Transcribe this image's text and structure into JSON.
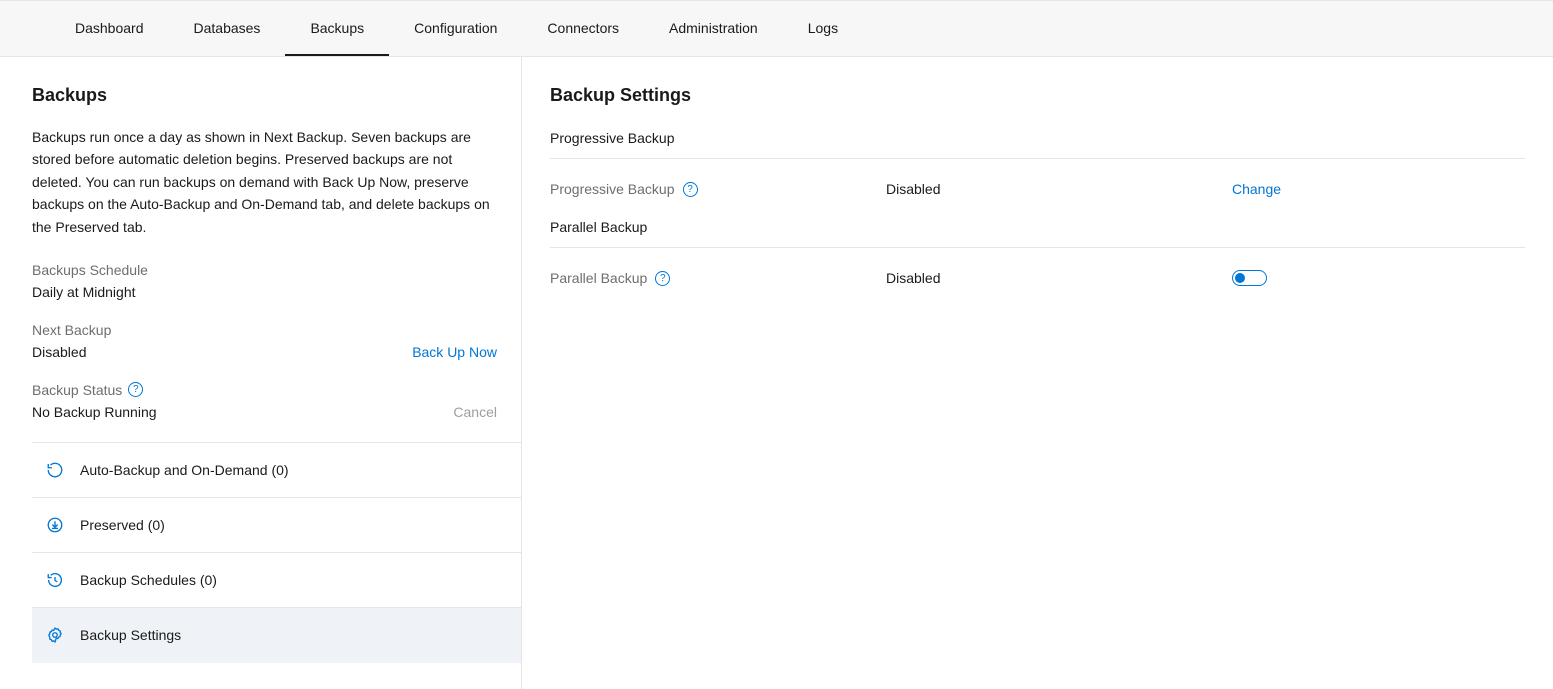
{
  "nav": {
    "items": [
      {
        "label": "Dashboard"
      },
      {
        "label": "Databases"
      },
      {
        "label": "Backups"
      },
      {
        "label": "Configuration"
      },
      {
        "label": "Connectors"
      },
      {
        "label": "Administration"
      },
      {
        "label": "Logs"
      }
    ],
    "active_index": 2
  },
  "left": {
    "title": "Backups",
    "description": "Backups run once a day as shown in Next Backup. Seven backups are stored before automatic deletion begins. Preserved backups are not deleted. You can run backups on demand with Back Up Now, preserve backups on the Auto-Backup and On-Demand tab, and delete backups on the Preserved tab.",
    "schedule": {
      "label": "Backups Schedule",
      "value": "Daily at Midnight"
    },
    "next_backup": {
      "label": "Next Backup",
      "value": "Disabled",
      "action": "Back Up Now"
    },
    "status": {
      "label": "Backup Status",
      "value": "No Backup Running",
      "action": "Cancel"
    },
    "side_items": [
      {
        "label": "Auto-Backup and On-Demand (0)"
      },
      {
        "label": "Preserved (0)"
      },
      {
        "label": "Backup Schedules (0)"
      },
      {
        "label": "Backup Settings"
      }
    ],
    "selected_side_index": 3
  },
  "right": {
    "title": "Backup Settings",
    "progressive": {
      "section": "Progressive Backup",
      "label": "Progressive Backup",
      "value": "Disabled",
      "action": "Change"
    },
    "parallel": {
      "section": "Parallel Backup",
      "label": "Parallel Backup",
      "value": "Disabled",
      "toggle_on": false
    }
  }
}
